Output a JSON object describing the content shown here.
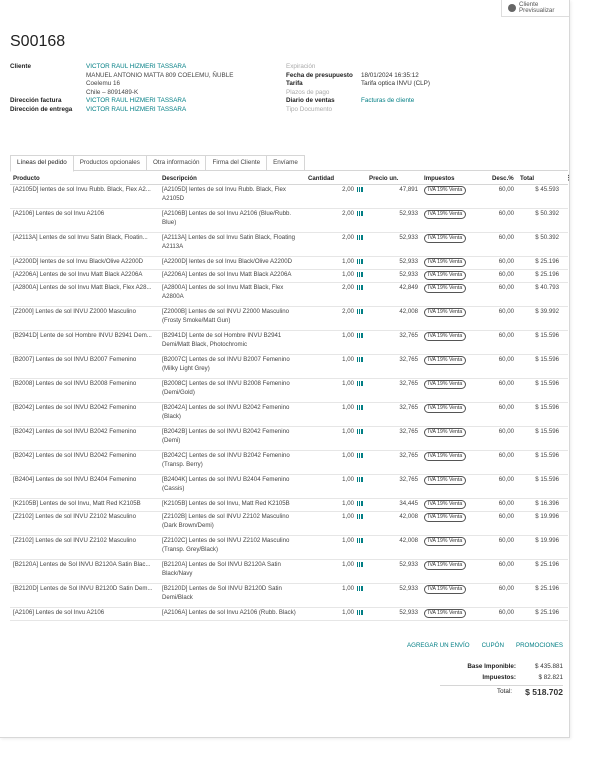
{
  "preview": {
    "line1": "Cliente",
    "line2": "Previsualizar"
  },
  "order": {
    "name": "S00168"
  },
  "info_left": {
    "customer_label": "Cliente",
    "customer_name": "VICTOR RAUL HIZMERI TASSARA",
    "address_lines": [
      "MANUEL ANTONIO MATTA 809 COELEMU, ÑUBLE",
      "Coelemu 16",
      "Chile – 8091489-K"
    ],
    "invoice_label": "Dirección factura",
    "invoice_value": "VICTOR RAUL HIZMERI TASSARA",
    "delivery_label": "Dirección de entrega",
    "delivery_value": "VICTOR RAUL HIZMERI TASSARA"
  },
  "info_right": {
    "expiration_label": "Expiración",
    "date_label": "Fecha de presupuesto",
    "date_value": "18/01/2024 16:35:12",
    "pricelist_label": "Tarifa",
    "pricelist_value": "Tarifa optica INVU (CLP)",
    "payment_terms_label": "Plazos de pago",
    "journal_label": "Diario de ventas",
    "journal_value": "Facturas de cliente",
    "doc_type_label": "Tipo Documento"
  },
  "tabs": [
    "Líneas del pedido",
    "Productos opcionales",
    "Otra información",
    "Firma del Cliente",
    "Envíame"
  ],
  "columns": {
    "product": "Producto",
    "description": "Descripción",
    "qty": "Cantidad",
    "price": "Precio un.",
    "taxes": "Impuestos",
    "disc": "Desc.%",
    "total": "Total"
  },
  "tax_label": "IVA 19% Venta",
  "lines": [
    {
      "product": "[A2105D] lentes de sol Invu Rubb. Black, Flex A2...",
      "desc": [
        "[A2105D] lentes de sol Invu Rubb. Black, Flex",
        "A2105D"
      ],
      "qty": "2,00",
      "price": "47,891",
      "disc": "60,00",
      "total": "$ 45.593"
    },
    {
      "product": "[A2106] Lentes de sol Invu A2106",
      "desc": [
        "[A2106B] Lentes de sol Invu A2106 (Blue/Rubb.",
        "Blue)"
      ],
      "qty": "2,00",
      "price": "52,933",
      "disc": "60,00",
      "total": "$ 50.392"
    },
    {
      "product": "[A2113A] Lentes de sol Invu Satin Black, Floatin...",
      "desc": [
        "[A2113A] Lentes de sol Invu Satin Black, Floating",
        "A2113A"
      ],
      "qty": "2,00",
      "price": "52,933",
      "disc": "60,00",
      "total": "$ 50.392"
    },
    {
      "product": "[A2200D] lentes de sol Invu Black/Olive A2200D",
      "desc": [
        "[A2200D] lentes de sol Invu Black/Olive A2200D"
      ],
      "qty": "1,00",
      "price": "52,933",
      "disc": "60,00",
      "total": "$ 25.196"
    },
    {
      "product": "[A2206A] Lentes de sol Invu Matt Black A2206A",
      "desc": [
        "[A2206A] Lentes de sol Invu Matt Black A2206A"
      ],
      "qty": "1,00",
      "price": "52,933",
      "disc": "60,00",
      "total": "$ 25.196"
    },
    {
      "product": "[A2800A] Lentes de sol Invu Matt Black, Flex A28...",
      "desc": [
        "[A2800A] Lentes de sol Invu Matt Black, Flex",
        "A2800A"
      ],
      "qty": "2,00",
      "price": "42,849",
      "disc": "60,00",
      "total": "$ 40.793"
    },
    {
      "product": "[Z2000] Lentes de sol INVU Z2000 Masculino",
      "desc": [
        "[Z2000B] Lentes de sol INVU Z2000 Masculino",
        "(Frosty Smoke/Matt Gun)"
      ],
      "qty": "2,00",
      "price": "42,008",
      "disc": "60,00",
      "total": "$ 39.992"
    },
    {
      "product": "[B2941D] Lente de sol Hombre INVU B2941 Dem...",
      "desc": [
        "[B2941D] Lente de sol Hombre INVU B2941",
        "Demi/Matt Black, Photochromic"
      ],
      "qty": "1,00",
      "price": "32,765",
      "disc": "60,00",
      "total": "$ 15.596"
    },
    {
      "product": "[B2007] Lentes de sol INVU B2007 Femenino",
      "desc": [
        "[B2007C] Lentes de sol INVU B2007 Femenino",
        "(Milky Light Grey)"
      ],
      "qty": "1,00",
      "price": "32,765",
      "disc": "60,00",
      "total": "$ 15.596"
    },
    {
      "product": "[B2008] Lentes de sol INVU B2008 Femenino",
      "desc": [
        "[B2008C] Lentes de sol INVU B2008 Femenino",
        "(Demi/Gold)"
      ],
      "qty": "1,00",
      "price": "32,765",
      "disc": "60,00",
      "total": "$ 15.596"
    },
    {
      "product": "[B2042] Lentes de sol INVU B2042 Femenino",
      "desc": [
        "[B2042A] Lentes de sol INVU B2042 Femenino",
        "(Black)"
      ],
      "qty": "1,00",
      "price": "32,765",
      "disc": "60,00",
      "total": "$ 15.596"
    },
    {
      "product": "[B2042] Lentes de sol INVU B2042 Femenino",
      "desc": [
        "[B2042B] Lentes de sol INVU B2042 Femenino",
        "(Demi)"
      ],
      "qty": "1,00",
      "price": "32,765",
      "disc": "60,00",
      "total": "$ 15.596"
    },
    {
      "product": "[B2042] Lentes de sol INVU B2042 Femenino",
      "desc": [
        "[B2042C] Lentes de sol INVU B2042 Femenino",
        "(Transp. Berry)"
      ],
      "qty": "1,00",
      "price": "32,765",
      "disc": "60,00",
      "total": "$ 15.596"
    },
    {
      "product": "[B2404] Lentes de sol INVU B2404 Femenino",
      "desc": [
        "[B2404K] Lentes de sol INVU B2404 Femenino",
        "(Cassis)"
      ],
      "qty": "1,00",
      "price": "32,765",
      "disc": "60,00",
      "total": "$ 15.596"
    },
    {
      "product": "[K2105B] Lentes de sol Invu, Matt Red K2105B",
      "desc": [
        "[K2105B] Lentes de sol Invu, Matt Red K2105B"
      ],
      "qty": "1,00",
      "price": "34,445",
      "disc": "60,00",
      "total": "$ 16.396"
    },
    {
      "product": "[Z2102] Lentes de sol INVU Z2102 Masculino",
      "desc": [
        "[Z2102B] Lentes de sol INVU Z2102 Masculino",
        "(Dark Brown/Demi)"
      ],
      "qty": "1,00",
      "price": "42,008",
      "disc": "60,00",
      "total": "$ 19.996"
    },
    {
      "product": "[Z2102] Lentes de sol INVU Z2102 Masculino",
      "desc": [
        "[Z2102C] Lentes de sol INVU Z2102 Masculino",
        "(Transp. Grey/Black)"
      ],
      "qty": "1,00",
      "price": "42,008",
      "disc": "60,00",
      "total": "$ 19.996"
    },
    {
      "product": "[B2120A] Lentes de Sol INVU B2120A Satin Blac...",
      "desc": [
        "[B2120A] Lentes de Sol INVU B2120A Satin",
        "Black/Navy"
      ],
      "qty": "1,00",
      "price": "52,933",
      "disc": "60,00",
      "total": "$ 25.196"
    },
    {
      "product": "[B2120D] Lentes de Sol INVU B2120D Satin Dem...",
      "desc": [
        "[B2120D] Lentes de Sol INVU B2120D Satin",
        "Demi/Black"
      ],
      "qty": "1,00",
      "price": "52,933",
      "disc": "60,00",
      "total": "$ 25.196"
    },
    {
      "product": "[A2106] Lentes de sol Invu A2106",
      "desc": [
        "[A2106A] Lentes de sol Invu A2106 (Rubb. Black)"
      ],
      "qty": "1,00",
      "price": "52,933",
      "disc": "60,00",
      "total": "$ 25.196"
    }
  ],
  "actions": [
    "AGREGAR UN ENVÍO",
    "CUPÓN",
    "PROMOCIONES"
  ],
  "totals": {
    "base_label": "Base Imponible:",
    "base_value": "$ 435.881",
    "tax_label": "Impuestos:",
    "tax_value": "$ 82.821",
    "total_label": "Total:",
    "total_value": "$ 518.702"
  },
  "colors": {
    "link": "#017e84",
    "border": "#d6d6d6"
  }
}
